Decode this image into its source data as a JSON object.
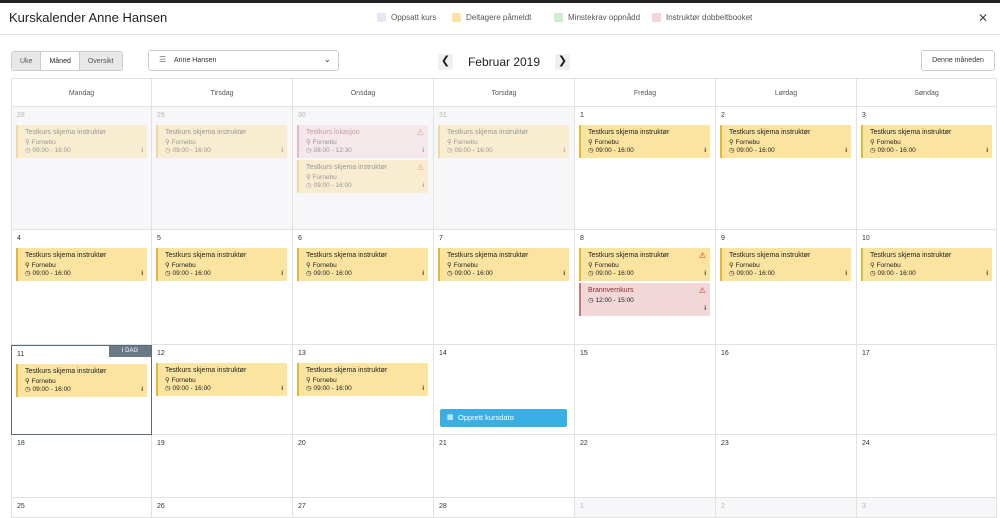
{
  "header": {
    "title": "Kurskalender Anne Hansen",
    "legend": [
      {
        "label": "Oppsatt kurs",
        "color": "#ebe4f6"
      },
      {
        "label": "Deltagere påmeldt",
        "color": "#fbe3a0"
      },
      {
        "label": "Minstekrav oppnådd",
        "color": "#cfeccf"
      },
      {
        "label": "Instruktør dobbeltbooket",
        "color": "#f2d7d9"
      }
    ],
    "close_glyph": "✕"
  },
  "toolbar": {
    "views": [
      "Uke",
      "Måned",
      "Oversikt"
    ],
    "active_view": "Måned",
    "person": "Anne Hansen",
    "person_icon": "user-icon",
    "prev_glyph": "❮",
    "next_glyph": "❯",
    "month_label": "Februar 2019",
    "today_button": "Denne måneden"
  },
  "calendar": {
    "weekdays": [
      "Mandag",
      "Tirsdag",
      "Onsdag",
      "Torsdag",
      "Fredag",
      "Lørdag",
      "Søndag"
    ],
    "today_badge": "I DAG",
    "create_label": "Opprett kursdato",
    "weeks": [
      [
        {
          "d": "28",
          "other": true,
          "events": [
            {
              "title": "Testkurs skjema instruktør",
              "loc": "Fornebu",
              "time": "09:00 - 16:00"
            }
          ]
        },
        {
          "d": "29",
          "other": true,
          "events": [
            {
              "title": "Testkurs skjema instruktør",
              "loc": "Fornebu",
              "time": "09:00 - 16:00"
            }
          ]
        },
        {
          "d": "30",
          "other": true,
          "events": [
            {
              "title": "Testkurs lokasjon",
              "loc": "Fornebu",
              "time": "08:00 - 12:30",
              "red": true,
              "warn": true
            },
            {
              "title": "Testkurs skjema instruktør",
              "loc": "Fornebu",
              "time": "09:00 - 16:00",
              "warn": true
            }
          ]
        },
        {
          "d": "31",
          "other": true,
          "events": [
            {
              "title": "Testkurs skjema instruktør",
              "loc": "Fornebu",
              "time": "09:00 - 16:00"
            }
          ]
        },
        {
          "d": "1",
          "events": [
            {
              "title": "Testkurs skjema instruktør",
              "loc": "Fornebu",
              "time": "09:00 - 16:00"
            }
          ]
        },
        {
          "d": "2",
          "events": [
            {
              "title": "Testkurs skjema instruktør",
              "loc": "Fornebu",
              "time": "09:00 - 16:00"
            }
          ]
        },
        {
          "d": "3",
          "events": [
            {
              "title": "Testkurs skjema instruktør",
              "loc": "Fornebu",
              "time": "09:00 - 16:00"
            }
          ]
        }
      ],
      [
        {
          "d": "4",
          "events": [
            {
              "title": "Testkurs skjema instruktør",
              "loc": "Fornebu",
              "time": "09:00 - 16:00"
            }
          ]
        },
        {
          "d": "5",
          "events": [
            {
              "title": "Testkurs skjema instruktør",
              "loc": "Fornebu",
              "time": "09:00 - 16:00"
            }
          ]
        },
        {
          "d": "6",
          "events": [
            {
              "title": "Testkurs skjema instruktør",
              "loc": "Fornebu",
              "time": "09:00 - 16:00"
            }
          ]
        },
        {
          "d": "7",
          "events": [
            {
              "title": "Testkurs skjema instruktør",
              "loc": "Fornebu",
              "time": "09:00 - 16:00"
            }
          ]
        },
        {
          "d": "8",
          "events": [
            {
              "title": "Testkurs skjema instruktør",
              "loc": "Fornebu",
              "time": "09:00 - 16:00",
              "warn": true
            },
            {
              "title": "Brannvernkurs",
              "time": "12:00 - 15:00",
              "red": true,
              "warn": true
            }
          ]
        },
        {
          "d": "9",
          "events": [
            {
              "title": "Testkurs skjema instruktør",
              "loc": "Fornebu",
              "time": "09:00 - 16:00"
            }
          ]
        },
        {
          "d": "10",
          "events": [
            {
              "title": "Testkurs skjema instruktør",
              "loc": "Fornebu",
              "time": "09:00 - 16:00"
            }
          ]
        }
      ],
      [
        {
          "d": "11",
          "today": true,
          "events": [
            {
              "title": "Testkurs skjema instruktør",
              "loc": "Fornebu",
              "time": "09:00 - 16:00"
            }
          ]
        },
        {
          "d": "12",
          "events": [
            {
              "title": "Testkurs skjema instruktør",
              "loc": "Fornebu",
              "time": "09:00 - 16:00"
            }
          ]
        },
        {
          "d": "13",
          "events": [
            {
              "title": "Testkurs skjema instruktør",
              "loc": "Fornebu",
              "time": "09:00 - 16:00"
            }
          ]
        },
        {
          "d": "14",
          "create": true,
          "events": []
        },
        {
          "d": "15",
          "events": []
        },
        {
          "d": "16",
          "events": []
        },
        {
          "d": "17",
          "events": []
        }
      ],
      [
        {
          "d": "18",
          "events": []
        },
        {
          "d": "19",
          "events": []
        },
        {
          "d": "20",
          "events": []
        },
        {
          "d": "21",
          "events": []
        },
        {
          "d": "22",
          "events": []
        },
        {
          "d": "23",
          "events": []
        },
        {
          "d": "24",
          "events": []
        }
      ],
      [
        {
          "d": "25",
          "events": []
        },
        {
          "d": "26",
          "events": []
        },
        {
          "d": "27",
          "events": []
        },
        {
          "d": "28",
          "events": []
        },
        {
          "d": "1",
          "other": true,
          "events": []
        },
        {
          "d": "2",
          "other": true,
          "events": []
        },
        {
          "d": "3",
          "other": true,
          "events": []
        }
      ]
    ]
  }
}
